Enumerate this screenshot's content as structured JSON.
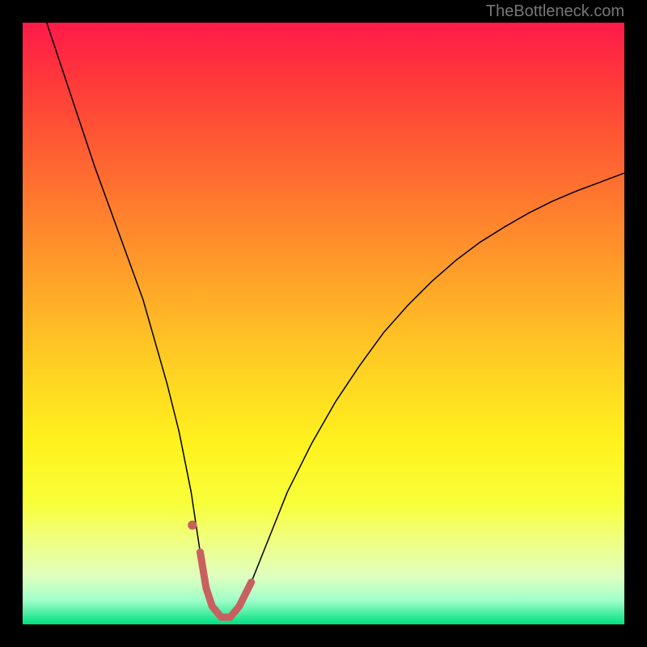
{
  "watermark": "TheBottleneck.com",
  "chart_data": {
    "type": "line",
    "title": "",
    "xlabel": "",
    "ylabel": "",
    "xlim": [
      0,
      100
    ],
    "ylim": [
      0,
      100
    ],
    "series": [
      {
        "name": "bottleneck-curve",
        "stroke": "#000000",
        "stroke_width": 1.5,
        "x": [
          4,
          8,
          12,
          16,
          20,
          24,
          26,
          28,
          29.5,
          30.5,
          31.5,
          33,
          34.5,
          36,
          38,
          40,
          44,
          48,
          52,
          56,
          60,
          64,
          68,
          72,
          76,
          80,
          84,
          88,
          92,
          96,
          100
        ],
        "y": [
          100,
          88,
          76,
          65,
          54,
          40,
          32,
          22,
          12,
          6,
          3,
          1.2,
          1.2,
          3,
          7,
          12,
          22,
          30,
          37,
          43,
          48.5,
          53,
          57,
          60.5,
          63.5,
          66,
          68.3,
          70.3,
          72,
          73.5,
          75
        ]
      },
      {
        "name": "highlight-band",
        "stroke": "#c86060",
        "stroke_width": 9,
        "x": [
          29.5,
          30.5,
          31.5,
          33,
          34.5,
          36,
          38
        ],
        "y": [
          12,
          6,
          3,
          1.2,
          1.2,
          3,
          7
        ]
      },
      {
        "name": "highlight-dot",
        "stroke": "#c86060",
        "stroke_width": 9,
        "x": [
          28.2
        ],
        "y": [
          16.5
        ]
      }
    ]
  }
}
